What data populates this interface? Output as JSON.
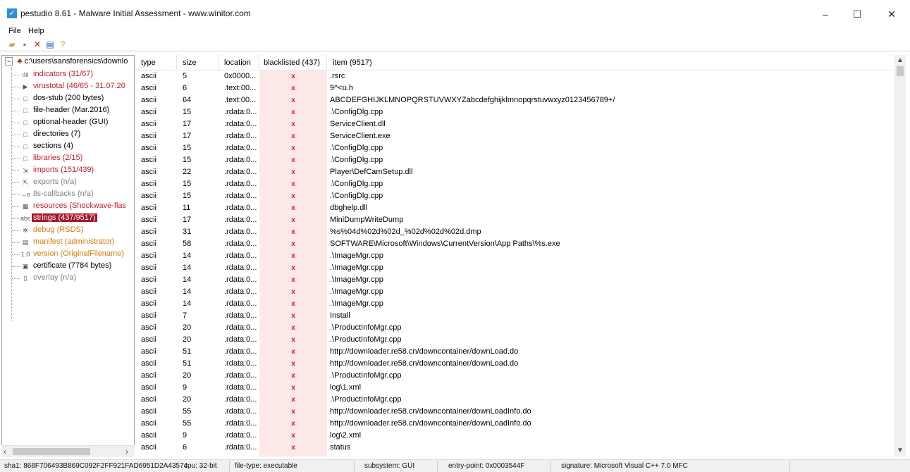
{
  "window": {
    "title": "pestudio 8.61 - Malware Initial Assessment - www.winitor.com",
    "minimize": "–",
    "maximize": "☐",
    "close": "✕"
  },
  "menu": [
    "File",
    "Help"
  ],
  "tree": {
    "root": "c:\\users\\sansforensics\\downlo",
    "nodes": [
      {
        "label": "indicators (31/67)",
        "icon": "bar-chart-icon",
        "glyph": "ılıl",
        "style": "red"
      },
      {
        "label": "virustotal (46/65 - 31.07.20",
        "icon": "arrow-icon",
        "glyph": "▶",
        "style": "red"
      },
      {
        "label": "dos-stub (200 bytes)",
        "icon": "box-icon",
        "glyph": "□",
        "style": ""
      },
      {
        "label": "file-header (Mar.2016)",
        "icon": "box-icon",
        "glyph": "□",
        "style": ""
      },
      {
        "label": "optional-header (GUI)",
        "icon": "box-icon",
        "glyph": "□",
        "style": ""
      },
      {
        "label": "directories (7)",
        "icon": "box-icon",
        "glyph": "□",
        "style": ""
      },
      {
        "label": "sections (4)",
        "icon": "box-icon",
        "glyph": "□",
        "style": ""
      },
      {
        "label": "libraries (2/15)",
        "icon": "box-icon",
        "glyph": "□",
        "style": "red"
      },
      {
        "label": "imports (151/439)",
        "icon": "import-icon",
        "glyph": "⇲",
        "style": "red"
      },
      {
        "label": "exports (n/a)",
        "icon": "export-icon",
        "glyph": "⇱",
        "style": "gray"
      },
      {
        "label": "tls-callbacks (n/a)",
        "icon": "callback-icon",
        "glyph": "→o",
        "style": "gray"
      },
      {
        "label": "resources (Shockwave-flas",
        "icon": "resources-icon",
        "glyph": "▦",
        "style": "red"
      },
      {
        "label": "strings (437/9517)",
        "icon": "strings-icon",
        "glyph": "abc",
        "style": "sel"
      },
      {
        "label": "debug (RSDS)",
        "icon": "debug-icon",
        "glyph": "✲",
        "style": "orange"
      },
      {
        "label": "manifest (administrator)",
        "icon": "manifest-icon",
        "glyph": "▤",
        "style": "orange"
      },
      {
        "label": "version (OriginalFilename)",
        "icon": "version-icon",
        "glyph": "1.0",
        "style": "orange"
      },
      {
        "label": "certificate (7784 bytes)",
        "icon": "certificate-icon",
        "glyph": "▣",
        "style": ""
      },
      {
        "label": "overlay (n/a)",
        "icon": "document-icon",
        "glyph": "▯",
        "style": "gray"
      }
    ]
  },
  "table": {
    "columns": [
      "type",
      "size",
      "location",
      "blacklisted (437)",
      "item (9517)"
    ],
    "blacklist_mark": "x",
    "rows": [
      [
        "ascii",
        "5",
        "0x0000...",
        ".rsrc"
      ],
      [
        "ascii",
        "6",
        ".text:00...",
        "9^<u.h"
      ],
      [
        "ascii",
        "64",
        ".text:00...",
        "ABCDEFGHIJKLMNOPQRSTUVWXYZabcdefghijklmnopqrstuvwxyz0123456789+/"
      ],
      [
        "ascii",
        "15",
        ".rdata:0...",
        ".\\ConfigDlg.cpp"
      ],
      [
        "ascii",
        "17",
        ".rdata:0...",
        "ServiceClient.dll"
      ],
      [
        "ascii",
        "17",
        ".rdata:0...",
        "ServiceClient.exe"
      ],
      [
        "ascii",
        "15",
        ".rdata:0...",
        ".\\ConfigDlg.cpp"
      ],
      [
        "ascii",
        "15",
        ".rdata:0...",
        ".\\ConfigDlg.cpp"
      ],
      [
        "ascii",
        "22",
        ".rdata:0...",
        "Player\\DefCamSetup.dll"
      ],
      [
        "ascii",
        "15",
        ".rdata:0...",
        ".\\ConfigDlg.cpp"
      ],
      [
        "ascii",
        "15",
        ".rdata:0...",
        ".\\ConfigDlg.cpp"
      ],
      [
        "ascii",
        "11",
        ".rdata:0...",
        "dbghelp.dll"
      ],
      [
        "ascii",
        "17",
        ".rdata:0...",
        "MiniDumpWriteDump"
      ],
      [
        "ascii",
        "31",
        ".rdata:0...",
        "%s%04d%02d%02d_%02d%02d%02d.dmp"
      ],
      [
        "ascii",
        "58",
        ".rdata:0...",
        "SOFTWARE\\Microsoft\\Windows\\CurrentVersion\\App Paths\\%s.exe"
      ],
      [
        "ascii",
        "14",
        ".rdata:0...",
        ".\\ImageMgr.cpp"
      ],
      [
        "ascii",
        "14",
        ".rdata:0...",
        ".\\ImageMgr.cpp"
      ],
      [
        "ascii",
        "14",
        ".rdata:0...",
        ".\\ImageMgr.cpp"
      ],
      [
        "ascii",
        "14",
        ".rdata:0...",
        ".\\ImageMgr.cpp"
      ],
      [
        "ascii",
        "14",
        ".rdata:0...",
        ".\\ImageMgr.cpp"
      ],
      [
        "ascii",
        "7",
        ".rdata:0...",
        "Install"
      ],
      [
        "ascii",
        "20",
        ".rdata:0...",
        ".\\ProductInfoMgr.cpp"
      ],
      [
        "ascii",
        "20",
        ".rdata:0...",
        ".\\ProductInfoMgr.cpp"
      ],
      [
        "ascii",
        "51",
        ".rdata:0...",
        "http://downloader.re58.cn/downcontainer/downLoad.do"
      ],
      [
        "ascii",
        "51",
        ".rdata:0...",
        "http://downloader.re58.cn/downcontainer/downLoad.do"
      ],
      [
        "ascii",
        "20",
        ".rdata:0...",
        ".\\ProductInfoMgr.cpp"
      ],
      [
        "ascii",
        "9",
        ".rdata:0...",
        "log\\1.xml"
      ],
      [
        "ascii",
        "20",
        ".rdata:0...",
        ".\\ProductInfoMgr.cpp"
      ],
      [
        "ascii",
        "55",
        ".rdata:0...",
        "http://downloader.re58.cn/downcontainer/downLoadInfo.do"
      ],
      [
        "ascii",
        "55",
        ".rdata:0...",
        "http://downloader.re58.cn/downcontainer/downLoadInfo.do"
      ],
      [
        "ascii",
        "9",
        ".rdata:0...",
        "log\\2.xml"
      ],
      [
        "ascii",
        "6",
        ".rdata:0...",
        "status"
      ]
    ]
  },
  "status": {
    "sha1": "sha1: 868F706493B869C092F2FF921FAD6951D2A43574",
    "cpu": "cpu: 32-bit",
    "filetype": "file-type: executable",
    "subsystem": "subsystem: GUI",
    "entry": "entry-point: 0x0003544F",
    "signature": "signature: Microsoft Visual C++ 7.0 MFC"
  },
  "colors": {
    "selected": "#a4162a",
    "alert": "#c0202a",
    "blacklist_bg": "#fde8e8"
  }
}
